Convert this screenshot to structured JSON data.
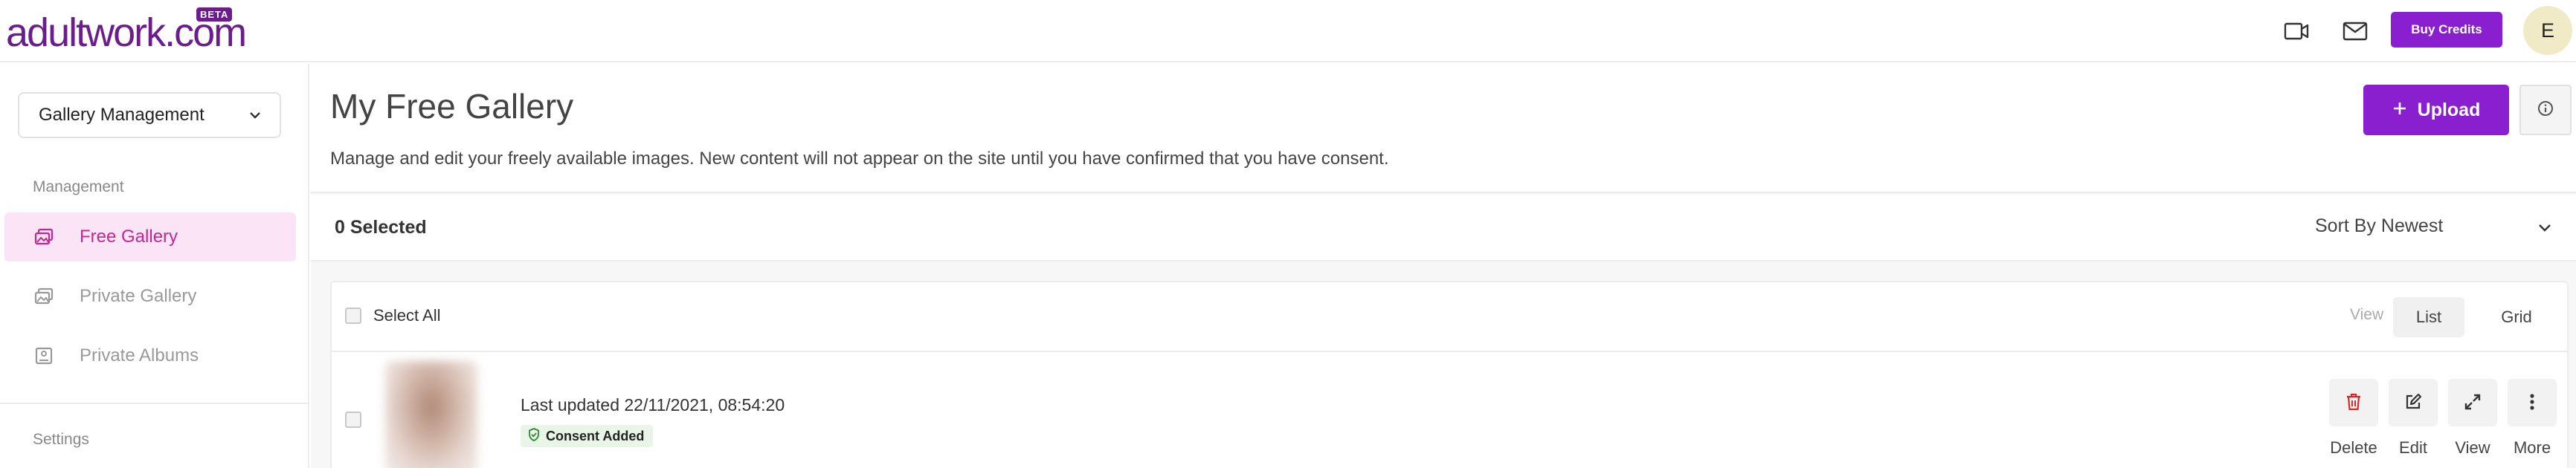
{
  "header": {
    "logo_text": "adultwork.com",
    "logo_badge": "BETA",
    "buy_credits_label": "Buy Credits",
    "avatar_initial": "E",
    "accent_color": "#8a1fcf",
    "brand_color": "#6b1d8c"
  },
  "sidebar": {
    "dropdown_value": "Gallery Management",
    "section_management": "Management",
    "items": [
      {
        "label": "Free Gallery",
        "icon": "gallery-icon",
        "active": true
      },
      {
        "label": "Private Gallery",
        "icon": "gallery-icon",
        "active": false
      },
      {
        "label": "Private Albums",
        "icon": "album-icon",
        "active": false
      }
    ],
    "section_settings": "Settings"
  },
  "main": {
    "title": "My Free Gallery",
    "description": "Manage and edit your freely available images. New content will not appear on the site until you have confirmed that you have consent.",
    "upload_label": "Upload",
    "selected_count": "0 Selected",
    "sort_value": "Sort By Newest",
    "select_all_label": "Select All",
    "view_label": "View",
    "view_options": [
      "List",
      "Grid"
    ],
    "active_view": "List",
    "items": [
      {
        "last_updated": "Last updated 22/11/2021, 08:54:20",
        "status": "Consent Added",
        "actions": [
          "Delete",
          "Edit",
          "View",
          "More"
        ]
      }
    ]
  }
}
